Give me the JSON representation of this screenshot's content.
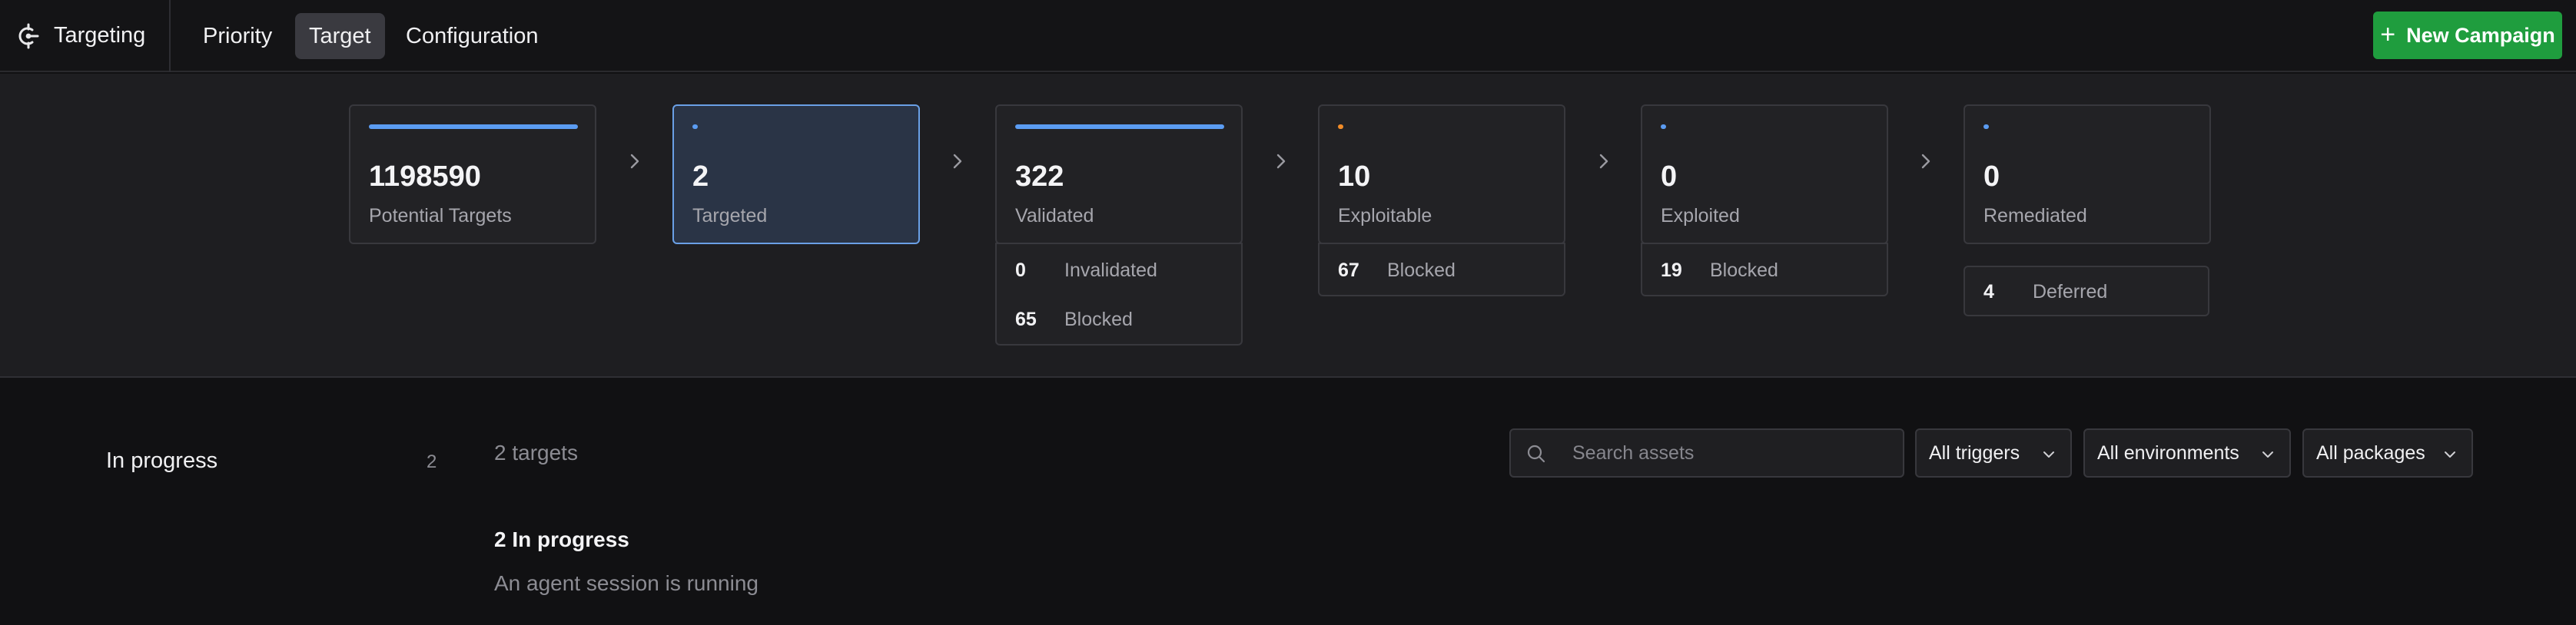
{
  "app": {
    "title": "Targeting"
  },
  "nav": {
    "tabs": [
      {
        "label": "Priority",
        "active": false
      },
      {
        "label": "Target",
        "active": true
      },
      {
        "label": "Configuration",
        "active": false
      }
    ]
  },
  "actions": {
    "new_campaign_label": "New Campaign"
  },
  "funnel": {
    "stages": [
      {
        "value": "1198590",
        "label": "Potential Targets",
        "bar_fill": 1.0,
        "bar_color": "#5b9cf2"
      },
      {
        "value": "2",
        "label": "Targeted",
        "bar_fill": 0.0,
        "bar_color": "#5b9cf2"
      },
      {
        "value": "322",
        "label": "Validated",
        "bar_fill": 1.0,
        "bar_color": "#5b9cf2"
      },
      {
        "value": "10",
        "label": "Exploitable",
        "bar_fill": 0.0,
        "bar_color": "#f28c28"
      },
      {
        "value": "0",
        "label": "Exploited",
        "bar_fill": 0.0,
        "bar_color": "#5b9cf2"
      },
      {
        "value": "0",
        "label": "Remediated",
        "bar_fill": 0.0,
        "bar_color": "#5b9cf2"
      }
    ],
    "validated_sub": [
      {
        "count": "0",
        "label": "Invalidated"
      },
      {
        "count": "65",
        "label": "Blocked"
      }
    ],
    "exploitable_sub": [
      {
        "count": "67",
        "label": "Blocked"
      }
    ],
    "exploited_sub": [
      {
        "count": "19",
        "label": "Blocked"
      }
    ],
    "remediated_sub": [
      {
        "count": "4",
        "label": "Deferred"
      }
    ]
  },
  "sidebar": {
    "status_label": "In progress",
    "status_count": "2"
  },
  "main": {
    "targets_count": "2 targets",
    "search_placeholder": "Search assets",
    "filters": {
      "triggers": "All triggers",
      "environments": "All environments",
      "packages": "All packages"
    },
    "group": {
      "title": "2 In progress",
      "description": "An agent session is running"
    }
  },
  "colors": {
    "accent_blue": "#5b9cf2",
    "accent_orange": "#f28c28",
    "primary_button": "#1f9d3e"
  }
}
